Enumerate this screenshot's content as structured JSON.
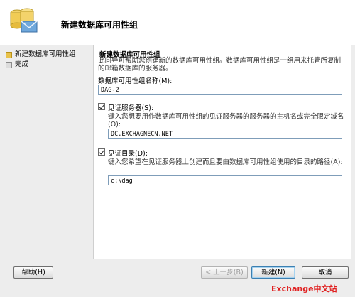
{
  "window": {
    "title": "新建数据库可用性组"
  },
  "nav": {
    "items": [
      {
        "label": "新建数据库可用性组",
        "active": true
      },
      {
        "label": "完成",
        "active": false
      }
    ]
  },
  "main": {
    "section_title": "新建数据库可用性组",
    "description": "此向导可帮助您创建新的数据库可用性组。数据库可用性组是一组用来托管所复制的邮箱数据库的服务器。",
    "dag_name": {
      "label": "数据库可用性组名称(M):",
      "value": "DAG-2"
    },
    "witness_server": {
      "checkbox_label": "见证服务器(S):",
      "checked": true,
      "prompt": "键入您想要用作数据库可用性组的见证服务器的服务器的主机名或完全限定域名(O):",
      "value": "DC.EXCHAGNECN.NET"
    },
    "witness_dir": {
      "checkbox_label": "见证目录(D):",
      "checked": true,
      "prompt": "键入您希望在见证服务器上创建而且要由数据库可用性组使用的目录的路径(A):",
      "value": "c:\\dag"
    }
  },
  "footer": {
    "help_label": "帮助(H)",
    "back_label": "< 上一步(B)",
    "next_label": "新建(N)",
    "cancel_label": "取消"
  },
  "watermark": "Exchange中文站",
  "colors": {
    "active_marker": "#e8c24a",
    "watermark": "#e02020",
    "textbox_border": "#7f9db9"
  }
}
